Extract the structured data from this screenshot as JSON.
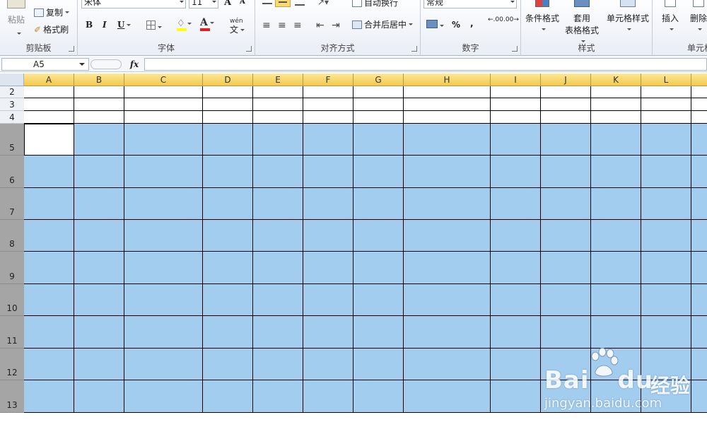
{
  "ribbon": {
    "clipboard": {
      "label": "剪贴板",
      "paste": "粘贴",
      "copy": "复制",
      "format_painter": "格式刷"
    },
    "font": {
      "label": "字体",
      "font_name": "宋体",
      "font_size": "11",
      "bold": "B",
      "italic": "I",
      "underline": "U",
      "grow": "A",
      "shrink": "A",
      "phonetic": "wén"
    },
    "alignment": {
      "label": "对齐方式",
      "wrap_text": "自动换行",
      "merge_center": "合并后居中"
    },
    "number": {
      "label": "数字",
      "format": "常规",
      "percent": "%",
      "comma": ",",
      "inc_decimal": ".00",
      "dec_decimal": ".00"
    },
    "styles": {
      "label": "样式",
      "conditional": "条件格式",
      "table_line1": "套用",
      "table_line2": "表格格式",
      "cell_styles": "单元格样式"
    },
    "cells": {
      "label": "单元格",
      "insert": "插入",
      "delete": "删除"
    }
  },
  "formula_bar": {
    "name_box": "A5",
    "fx": "fx",
    "value": ""
  },
  "sheet": {
    "columns": [
      "A",
      "B",
      "C",
      "D",
      "E",
      "F",
      "G",
      "H",
      "I",
      "J",
      "K",
      "L"
    ],
    "rows": [
      "2",
      "3",
      "4",
      "5",
      "6",
      "7",
      "8",
      "9",
      "10",
      "11",
      "12",
      "13"
    ],
    "active_cell": "A5",
    "selected_rows": [
      "5",
      "6",
      "7",
      "8",
      "9",
      "10",
      "11",
      "12",
      "13"
    ],
    "selection_color": "#a3cdee"
  },
  "watermark": {
    "brand": "Bai",
    "brand2": "du",
    "suffix": "经验",
    "url": "jingyan.baidu.com"
  }
}
